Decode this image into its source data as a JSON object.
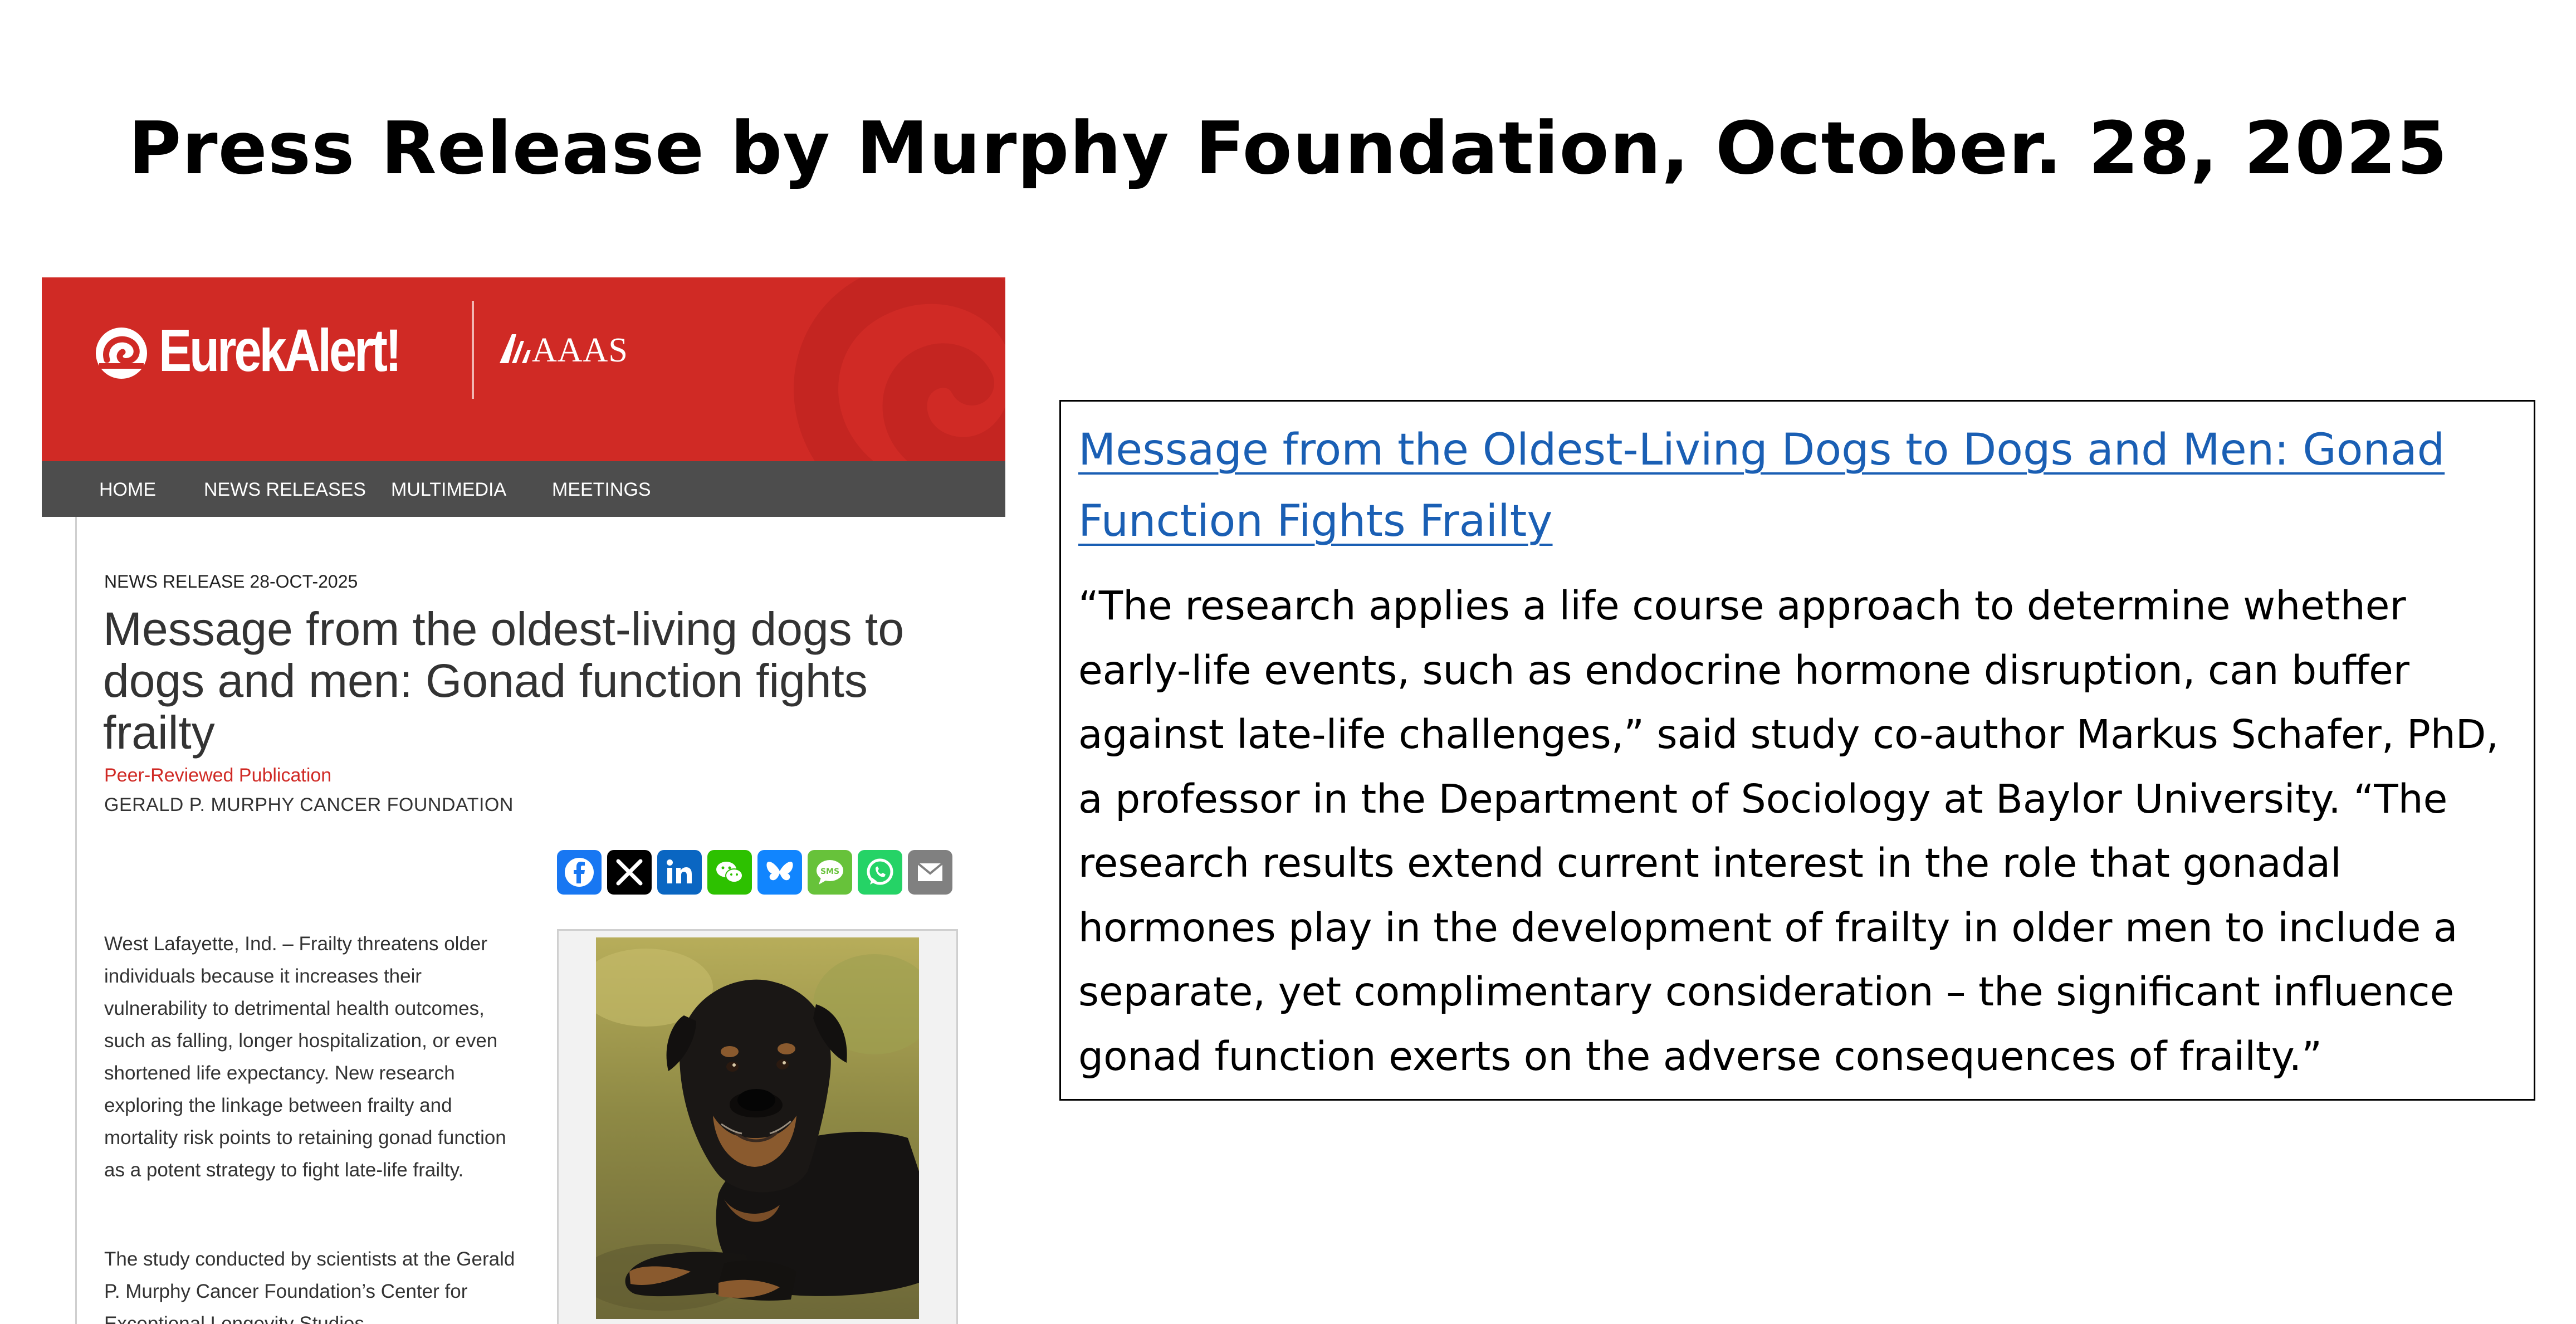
{
  "slide_title": "Press Release by Murphy Foundation, October. 28, 2025",
  "screenshot": {
    "brand": {
      "logo_text": "EurekAlert!",
      "partner_text": "AAAS"
    },
    "colors": {
      "header_red": "#d02a25",
      "nav_gray": "#4d4d4d",
      "peer_red": "#d02a25"
    },
    "nav": [
      "HOME",
      "NEWS RELEASES",
      "MULTIMEDIA",
      "MEETINGS"
    ],
    "release_date": "NEWS RELEASE 28-OCT-2025",
    "article_title": "Message from the oldest-living dogs to dogs and men: Gonad function fights frailty",
    "peer_reviewed": "Peer-Reviewed Publication",
    "organization": "GERALD P. MURPHY CANCER FOUNDATION",
    "share_icons": [
      "facebook-icon",
      "x-icon",
      "linkedin-icon",
      "wechat-icon",
      "bluesky-icon",
      "sms-icon",
      "whatsapp-icon",
      "email-icon"
    ],
    "paragraph_1": "West Lafayette, Ind. – Frailty threatens older individuals because it increases their vulnerability to detrimental health outcomes, such as falling, longer hospitalization, or even shortened life expectancy.  New research exploring the linkage between frailty and mortality risk points to retaining gonad function as a potent strategy to fight late-life frailty.",
    "paragraph_2": "The study conducted by scientists at the Gerald P. Murphy Cancer Foundation’s Center for Exceptional Longevity Studies"
  },
  "quote_box": {
    "link_text": "Message from the Oldest-Living Dogs to Dogs and Men: Gonad Function Fights Frailty",
    "link_color": "#1a5fb4",
    "quote": "“The research applies a life course approach to determine whether early-life events, such as endocrine hormone disruption, can buffer against late-life challenges,” said study co-author Markus Schafer, PhD, a professor in the Department of Sociology at Baylor University. “The research results extend current interest in the role that gonadal hormones play in the development of frailty in older men to include a separate, yet complimentary consideration – the significant influence gonad function exerts on the adverse consequences of frailty.”"
  }
}
